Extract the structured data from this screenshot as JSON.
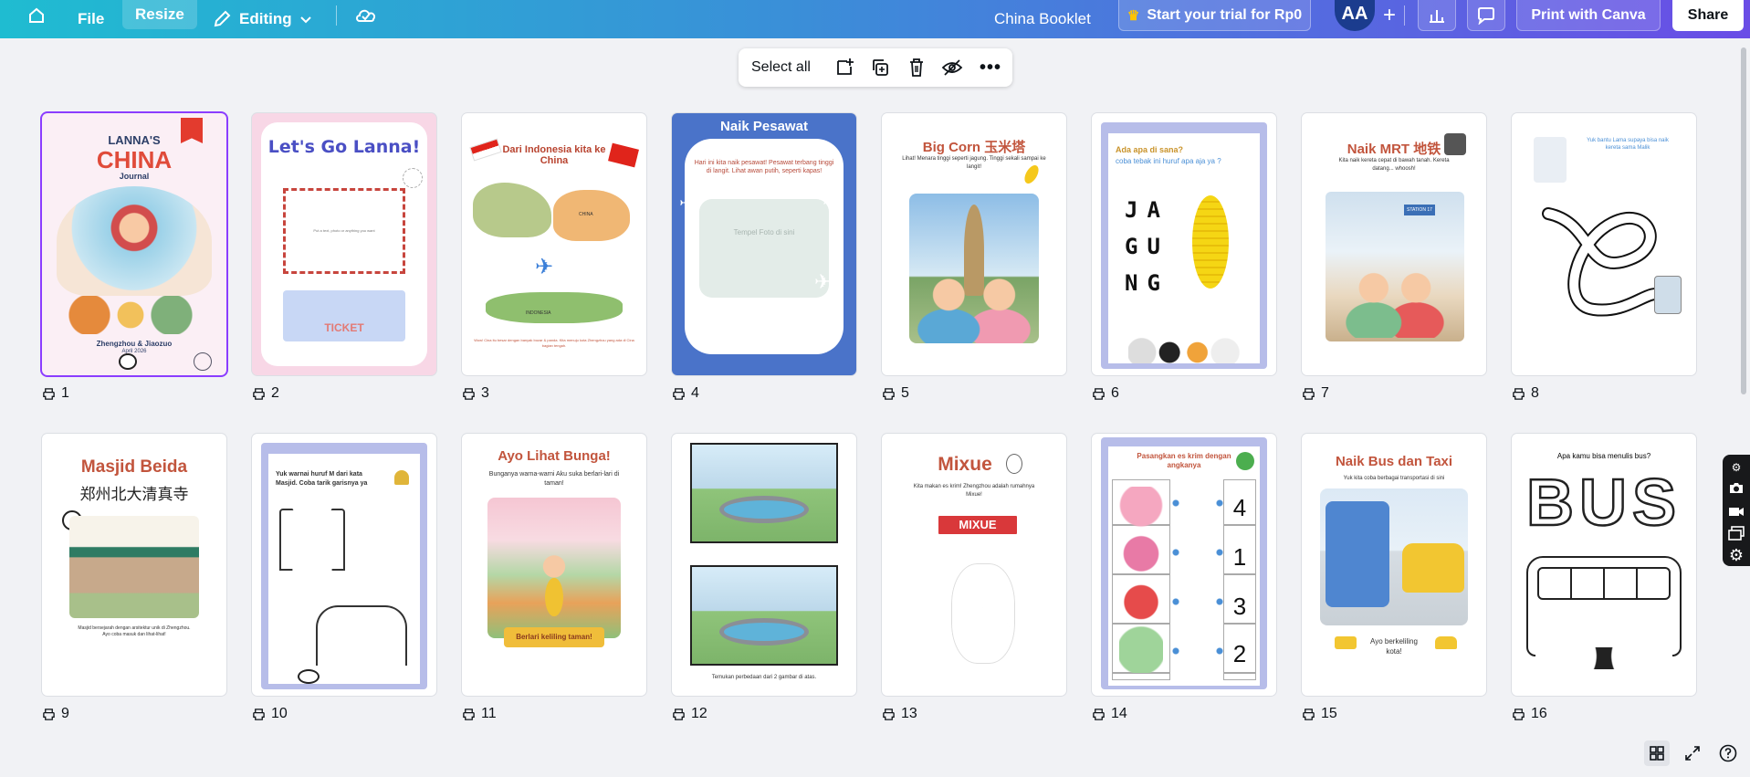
{
  "topbar": {
    "file_label": "File",
    "resize_label": "Resize",
    "editing_label": "Editing",
    "doc_title": "China Booklet",
    "trial_label": "Start your trial for Rp0",
    "avatar_initials": "AA",
    "print_label": "Print with Canva",
    "share_label": "Share"
  },
  "toolbar": {
    "select_all_label": "Select all"
  },
  "pages": [
    {
      "number": "1",
      "title": "LANNA'S",
      "title2": "CHINA",
      "sub": "Journal",
      "caption": "Zhengzhou & Jiaozuo",
      "caption2": "April 2026"
    },
    {
      "number": "2",
      "title": "Let's Go Lanna!",
      "box": "Put a text, photo or anything you want",
      "ticket": "TICKET"
    },
    {
      "number": "3",
      "title": "Dari Indonesia kita ke China",
      "map1": "CHINA",
      "map2": "INDONESIA",
      "caption": "Wow! Cina itu besar dengan banyak bozar & panda. Kita menuju kota Zhengzhou yang ada di Cina bagian tengah."
    },
    {
      "number": "4",
      "title": "Naik Pesawat",
      "text": "Hari ini kita naik pesawat! Pesawat terbang tinggi di langit. Lihat awan putih, seperti kapas!",
      "photo": "Tempel Foto di sini"
    },
    {
      "number": "5",
      "title": "Big Corn 玉米塔",
      "text": "Lihat! Menara tinggi seperti jagung. Tinggi sekali sampai ke langit!"
    },
    {
      "number": "6",
      "title": "Ada apa di sana?",
      "text": "coba tebak ini huruf apa aja ya ?",
      "letters": "JAGUNG"
    },
    {
      "number": "7",
      "title": "Naik MRT 地铁",
      "text": "Kita naik kereta cepat di bawah tanah. Kereta datang... whoosh!",
      "station": "STATION 17"
    },
    {
      "number": "8",
      "text": "Yuk bantu Lama supaya bisa naik kereta sama Malik"
    },
    {
      "number": "9",
      "title": "Masjid Beida",
      "title2": "郑州北大清真寺",
      "caption": "Masjid bersejarah dengan arsitektur unik di Zhengzhou. Ayo coba masuk dan lihat-lihat!"
    },
    {
      "number": "10",
      "title": "Yuk warnai huruf M dari kata",
      "title2": "Masjid. Coba tarik garisnya ya"
    },
    {
      "number": "11",
      "title": "Ayo Lihat Bunga!",
      "text": "Bunganya warna-warni Aku suka berlari-lari di taman!",
      "banner": "Berlari keliling taman!"
    },
    {
      "number": "12",
      "caption": "Temukan perbedaan dari 2 gambar di atas."
    },
    {
      "number": "13",
      "title": "Mixue",
      "text": "Kita makan es krim! Zhengzhou adalah rumahnya Mixue!",
      "sign": "MIXUE"
    },
    {
      "number": "14",
      "title": "Pasangkan es krim dengan angkanya",
      "nums": [
        "4",
        "1",
        "3",
        "2"
      ]
    },
    {
      "number": "15",
      "title": "Naik Bus dan Taxi",
      "text": "Yuk kita coba berbagai transportasi di sini",
      "caption": "Ayo berkeliling kota!"
    },
    {
      "number": "16",
      "title": "Apa kamu bisa menulis bus?",
      "word": "BUS"
    }
  ],
  "colors": {
    "accent": "#8b3dff",
    "brand_from": "#1fbcd1",
    "brand_to": "#6a4de6",
    "avatar": "#1b3c8e"
  }
}
